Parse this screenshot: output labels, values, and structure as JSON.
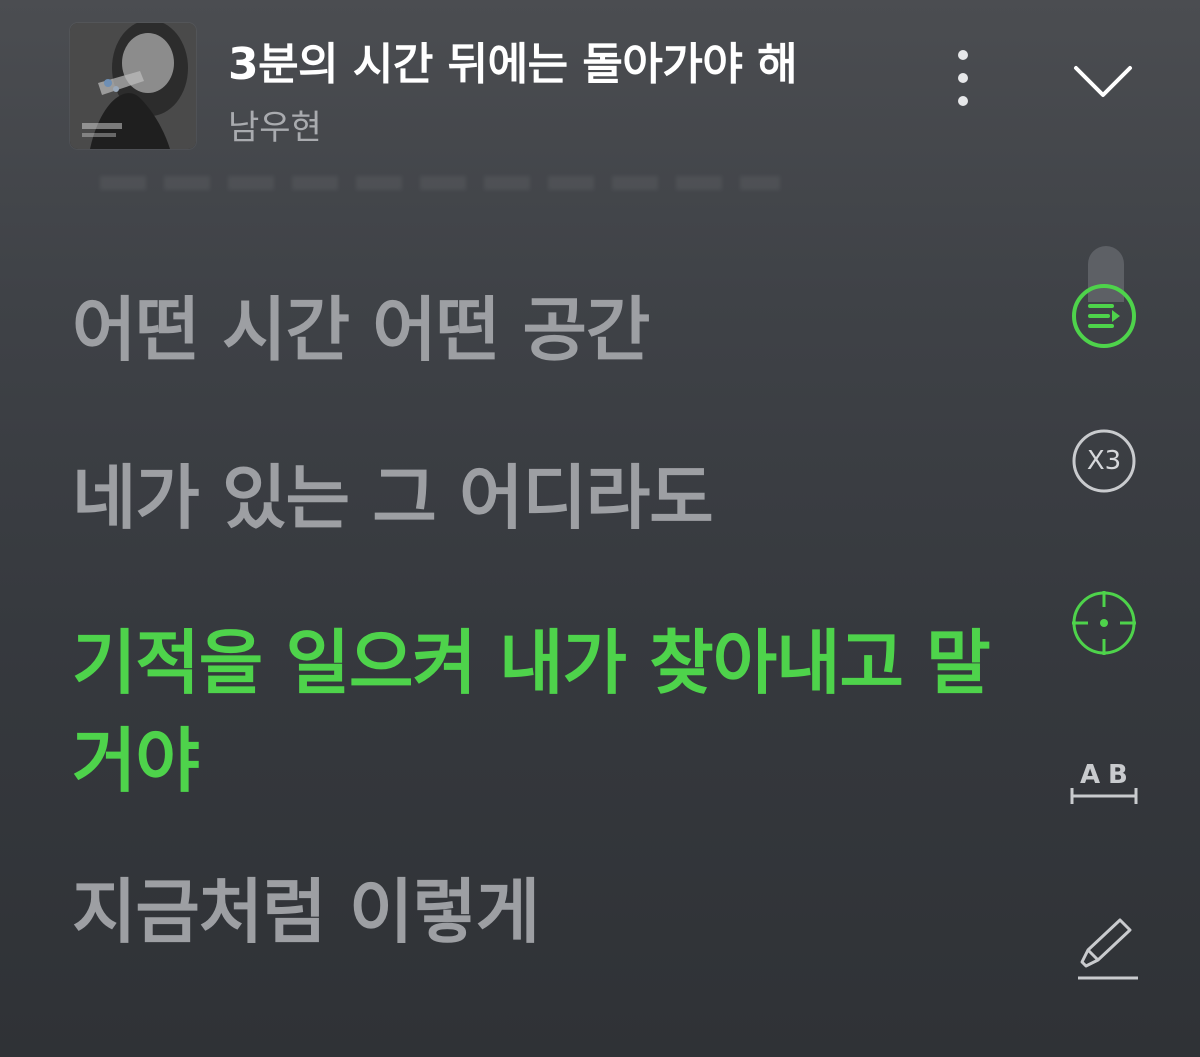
{
  "header": {
    "title": "3분의 시간 뒤에는 돌아가야 해",
    "artist": "남우현",
    "album_art_alt": "album cover"
  },
  "lyrics": [
    {
      "text": "어떤 시간 어떤 공간",
      "active": false
    },
    {
      "text": "네가 있는 그 어디라도",
      "active": false
    },
    {
      "text": "기적을 일으켜 내가 찾아내고 말 거야",
      "active": true
    },
    {
      "text": "지금처럼 이렇게",
      "active": false
    }
  ],
  "side_controls": {
    "speed_label": "X3",
    "ab_label_a": "A",
    "ab_label_b": "B"
  },
  "colors": {
    "accent": "#4ed34b",
    "lyric_inactive": "#9d9fa3",
    "artist": "#a9abaf",
    "icon": "#c9cbce"
  },
  "icons": {
    "more": "vertical-dots-icon",
    "close": "chevron-down-icon",
    "playlist": "playlist-play-icon",
    "speed": "speed-x3-icon",
    "focus": "crosshair-icon",
    "ab_repeat": "ab-repeat-icon",
    "edit": "pen-icon"
  }
}
